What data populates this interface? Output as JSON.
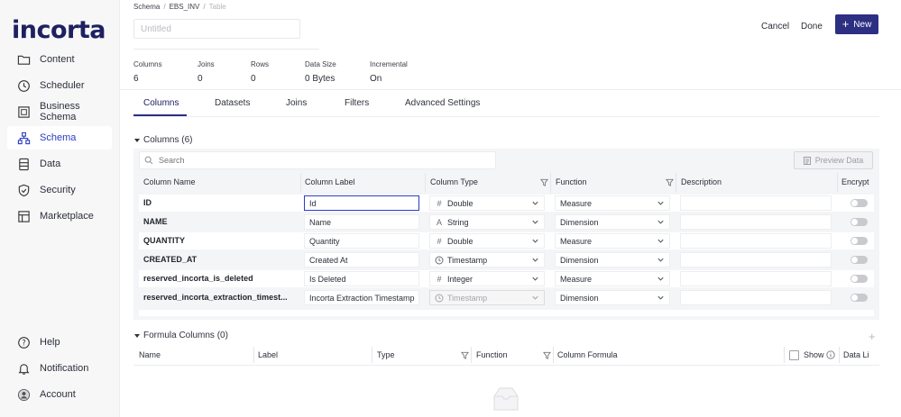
{
  "app": {
    "logo": "incorta"
  },
  "sidebar": {
    "items": [
      {
        "label": "Content",
        "icon": "folder-icon"
      },
      {
        "label": "Scheduler",
        "icon": "clock-icon"
      },
      {
        "label": "Business Schema",
        "icon": "business-schema-icon"
      },
      {
        "label": "Schema",
        "icon": "schema-icon",
        "active": true
      },
      {
        "label": "Data",
        "icon": "database-icon"
      },
      {
        "label": "Security",
        "icon": "shield-icon"
      },
      {
        "label": "Marketplace",
        "icon": "marketplace-icon"
      }
    ],
    "bottom": [
      {
        "label": "Help",
        "icon": "help-icon"
      },
      {
        "label": "Notification",
        "icon": "bell-icon"
      },
      {
        "label": "Account",
        "icon": "account-icon"
      }
    ]
  },
  "breadcrumb": {
    "schema": "Schema",
    "ebs": "EBS_INV",
    "table": "Table"
  },
  "title_input": {
    "placeholder": "Untitled",
    "value": ""
  },
  "actions": {
    "cancel": "Cancel",
    "done": "Done",
    "new": "New"
  },
  "stats": [
    {
      "label": "Columns",
      "value": "6"
    },
    {
      "label": "Joins",
      "value": "0"
    },
    {
      "label": "Rows",
      "value": "0"
    },
    {
      "label": "Data Size",
      "value": "0 Bytes"
    },
    {
      "label": "Incremental",
      "value": "On"
    }
  ],
  "tabs": [
    "Columns",
    "Datasets",
    "Joins",
    "Filters",
    "Advanced Settings"
  ],
  "columns_section": {
    "title": "Columns (6)",
    "search_placeholder": "Search",
    "preview_label": "Preview Data",
    "headers": {
      "name": "Column Name",
      "label": "Column Label",
      "type": "Column Type",
      "function": "Function",
      "description": "Description",
      "encrypt": "Encrypt"
    },
    "rows": [
      {
        "name": "ID",
        "label": "Id",
        "type": "Double",
        "type_symbol": "#",
        "function": "Measure"
      },
      {
        "name": "NAME",
        "label": "Name",
        "type": "String",
        "type_symbol": "A",
        "function": "Dimension"
      },
      {
        "name": "QUANTITY",
        "label": "Quantity",
        "type": "Double",
        "type_symbol": "#",
        "function": "Measure"
      },
      {
        "name": "CREATED_AT",
        "label": "Created At",
        "type": "Timestamp",
        "type_symbol": "clock",
        "function": "Dimension"
      },
      {
        "name": "reserved_incorta_is_deleted",
        "label": "Is Deleted",
        "type": "Integer",
        "type_symbol": "#",
        "function": "Measure"
      },
      {
        "name": "reserved_incorta_extraction_timest...",
        "label": "Incorta Extraction Timestamp",
        "type": "Timestamp",
        "type_symbol": "clock",
        "function": "Dimension",
        "type_disabled": true
      }
    ]
  },
  "formula_section": {
    "title": "Formula Columns (0)",
    "headers": {
      "name": "Name",
      "label": "Label",
      "type": "Type",
      "function": "Function",
      "formula": "Column Formula",
      "show": "Show",
      "data_lineage": "Data Li"
    }
  }
}
